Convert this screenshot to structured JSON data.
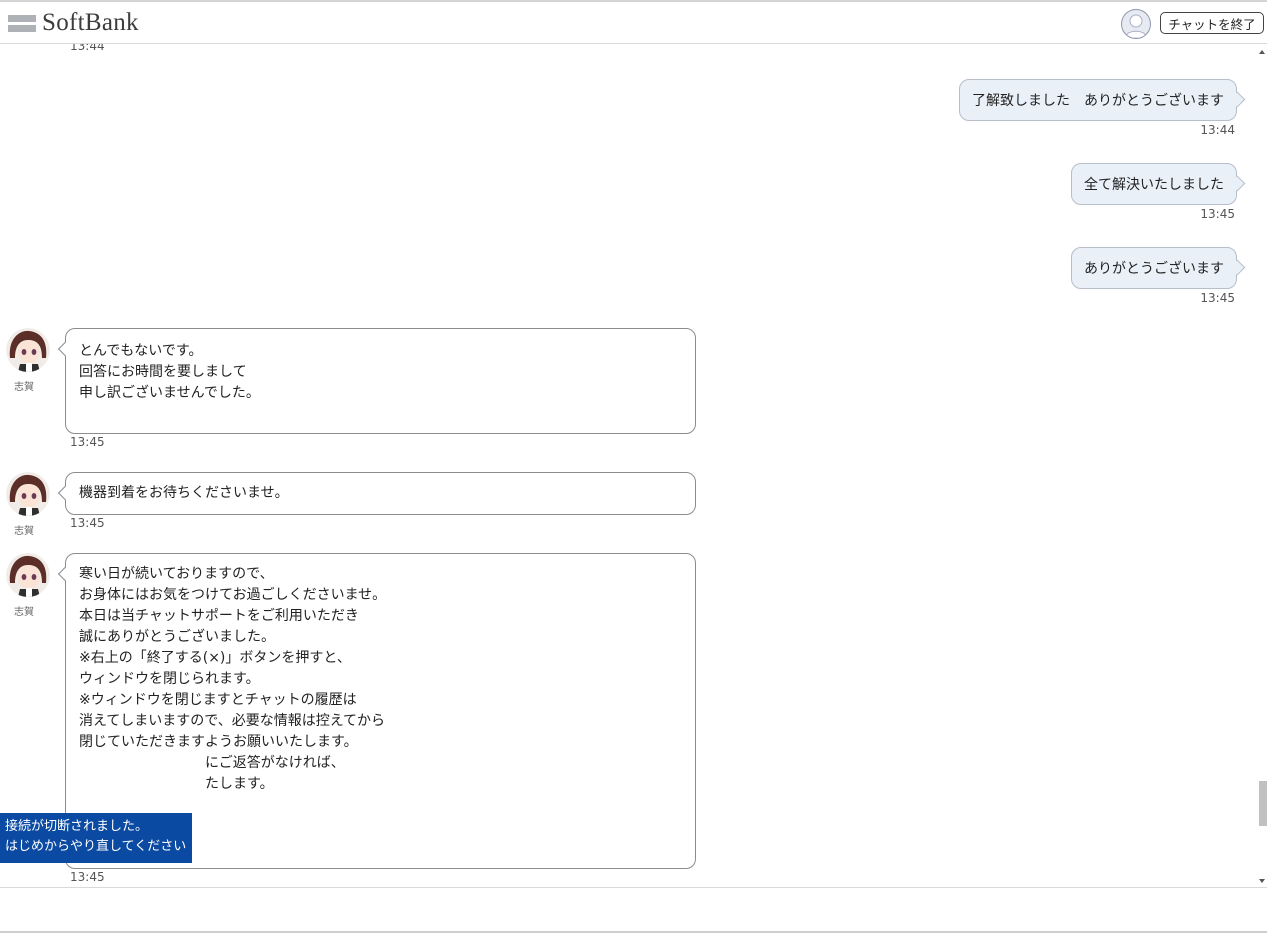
{
  "header": {
    "logo_text": "SoftBank",
    "end_chat_button": "チャットを終了"
  },
  "chat": {
    "top_time": "13:44",
    "user_messages": [
      {
        "text": "了解致しました　ありがとうございます",
        "time": "13:44"
      },
      {
        "text": "全て解決いたしました",
        "time": "13:45"
      },
      {
        "text": "ありがとうございます",
        "time": "13:45"
      }
    ],
    "agent_name": "志賀",
    "agent_messages": [
      {
        "lines": [
          "とんでもないです。",
          "",
          "回答にお時間を要しまして",
          "申し訳ございませんでした。"
        ],
        "time": "13:45"
      },
      {
        "lines": [
          "機器到着をお待ちくださいませ。"
        ],
        "time": "13:45"
      },
      {
        "lines": [
          "",
          "寒い日が続いておりますので、",
          "お身体にはお気をつけてお過ごしくださいませ。",
          "",
          "本日は当チャットサポートをご利用いただき",
          "誠にありがとうございました。",
          "",
          "※右上の「終了する(×)」ボタンを押すと、",
          "ウィンドウを閉じられます。",
          "※ウィンドウを閉じますとチャットの履歴は",
          "消えてしまいますので、必要な情報は控えてから",
          "閉じていただきますようお願いいたします。",
          "　　　　　　　　　にご返答がなければ、",
          "　　　　　　　　　たします。"
        ],
        "time": "13:45"
      }
    ]
  },
  "toast": {
    "line1": "接続が切断されました。",
    "line2": "はじめからやり直してください"
  },
  "colors": {
    "user_bubble": "#eaf0f8",
    "toast_bg": "#0b4aa2"
  }
}
